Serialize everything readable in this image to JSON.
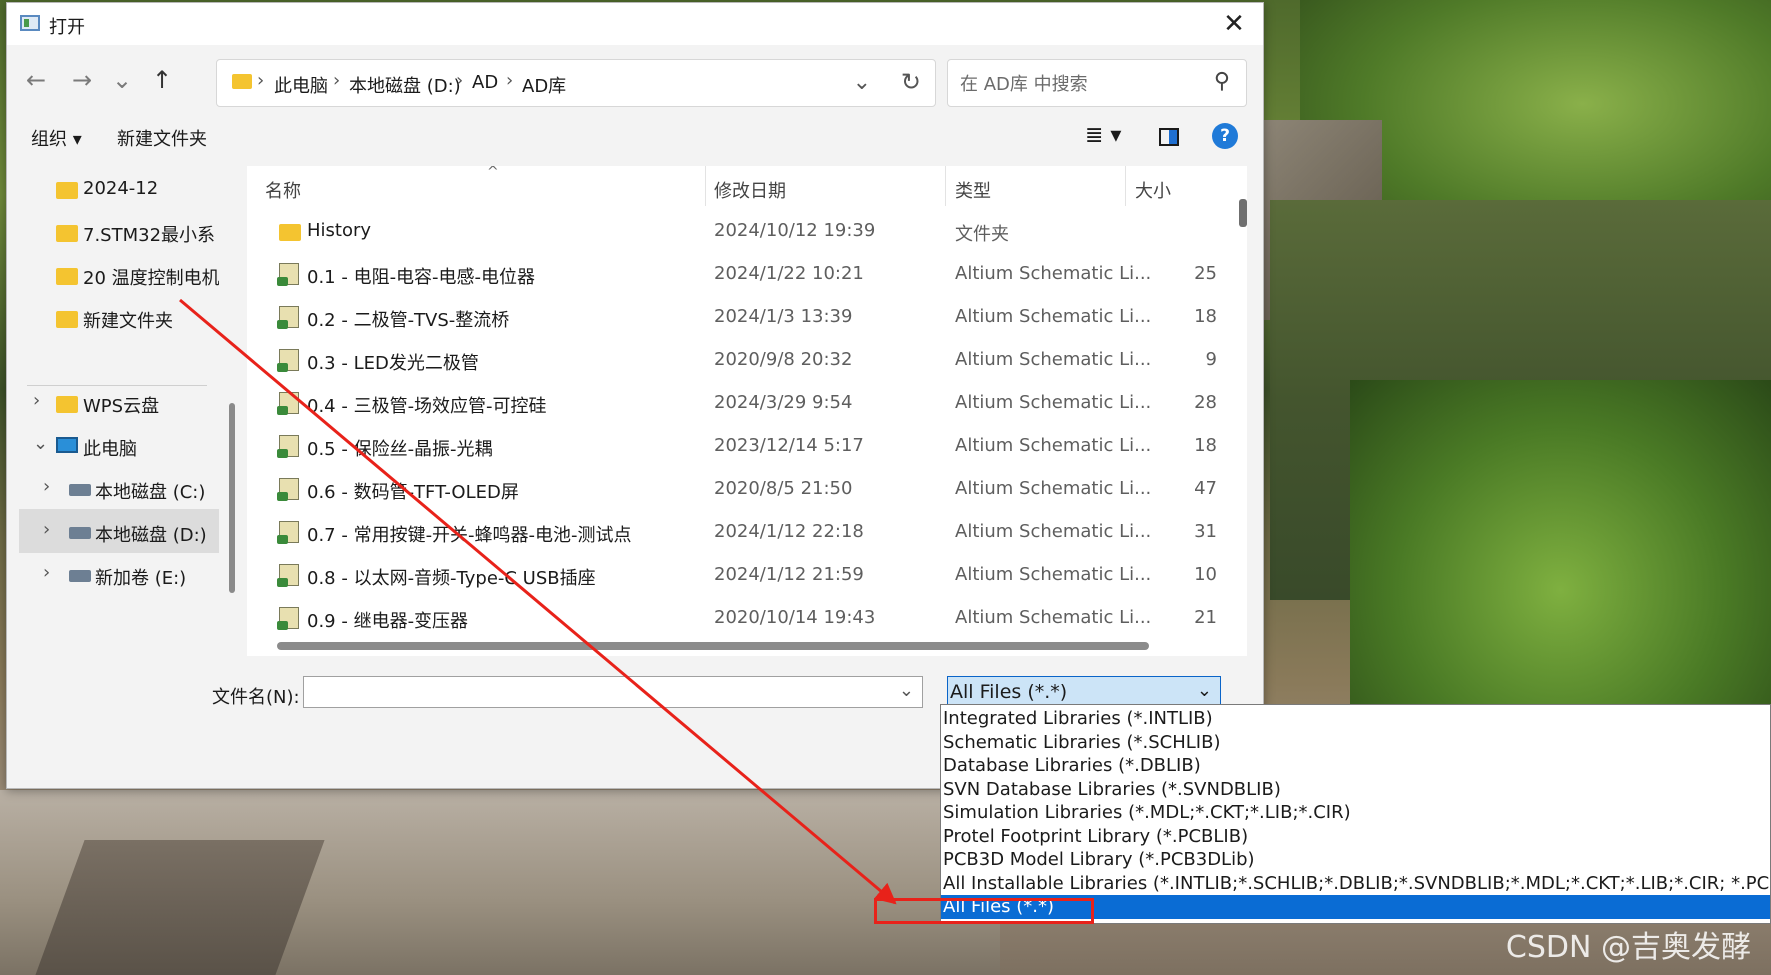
{
  "window": {
    "title": "打开",
    "close": "✕"
  },
  "nav": {
    "back": "←",
    "forward": "→",
    "recent": "⌄",
    "up": "↑"
  },
  "address": {
    "crumbs": [
      "此电脑",
      "本地磁盘 (D:)",
      "AD",
      "AD库"
    ],
    "separator": "›",
    "dropdown": "⌄",
    "refresh": "↻"
  },
  "search": {
    "placeholder": "在 AD库 中搜索",
    "icon": "search-icon"
  },
  "toolbar": {
    "organize": "组织 ▾",
    "new_folder": "新建文件夹",
    "view": "≣ ▾",
    "help": "?"
  },
  "sidebar": {
    "items": [
      {
        "label": "2024-12",
        "icon": "folder-icon"
      },
      {
        "label": "7.STM32最小系",
        "icon": "folder-icon"
      },
      {
        "label": "20 温度控制电机",
        "icon": "folder-icon"
      },
      {
        "label": "新建文件夹",
        "icon": "folder-icon"
      },
      {
        "label": "WPS云盘",
        "icon": "folder-icon",
        "chevron": "›"
      },
      {
        "label": "此电脑",
        "icon": "pc-icon",
        "chevron": "⌄"
      },
      {
        "label": "本地磁盘 (C:)",
        "icon": "drive-icon",
        "chevron": "›"
      },
      {
        "label": "本地磁盘 (D:)",
        "icon": "drive-icon",
        "chevron": "›",
        "selected": true
      },
      {
        "label": "新加卷 (E:)",
        "icon": "drive-icon",
        "chevron": "›"
      }
    ]
  },
  "columns": {
    "name": "名称",
    "date": "修改日期",
    "type": "类型",
    "size": "大小",
    "sort_indicator": "^"
  },
  "files": [
    {
      "name": "History",
      "date": "2024/10/12 19:39",
      "type": "文件夹",
      "size": "",
      "kind": "folder"
    },
    {
      "name": "0.1 - 电阻-电容-电感-电位器",
      "date": "2024/1/22 10:21",
      "type": "Altium Schematic Li...",
      "size": "25",
      "kind": "lib"
    },
    {
      "name": "0.2 - 二极管-TVS-整流桥",
      "date": "2024/1/3 13:39",
      "type": "Altium Schematic Li...",
      "size": "18",
      "kind": "lib"
    },
    {
      "name": "0.3 - LED发光二极管",
      "date": "2020/9/8 20:32",
      "type": "Altium Schematic Li...",
      "size": "9",
      "kind": "lib"
    },
    {
      "name": "0.4 - 三极管-场效应管-可控硅",
      "date": "2024/3/29 9:54",
      "type": "Altium Schematic Li...",
      "size": "28",
      "kind": "lib"
    },
    {
      "name": "0.5 - 保险丝-晶振-光耦",
      "date": "2023/12/14 5:17",
      "type": "Altium Schematic Li...",
      "size": "18",
      "kind": "lib"
    },
    {
      "name": "0.6 - 数码管-TFT-OLED屏",
      "date": "2020/8/5 21:50",
      "type": "Altium Schematic Li...",
      "size": "47",
      "kind": "lib"
    },
    {
      "name": "0.7 - 常用按键-开关-蜂鸣器-电池-测试点",
      "date": "2024/1/12 22:18",
      "type": "Altium Schematic Li...",
      "size": "31",
      "kind": "lib"
    },
    {
      "name": "0.8 - 以太网-音频-Type-C USB插座",
      "date": "2024/1/12 21:59",
      "type": "Altium Schematic Li...",
      "size": "10",
      "kind": "lib"
    },
    {
      "name": "0.9 - 继电器-变压器",
      "date": "2020/10/14 19:43",
      "type": "Altium Schematic Li...",
      "size": "21",
      "kind": "lib"
    }
  ],
  "bottom": {
    "filename_label": "文件名(N):",
    "filename_value": "",
    "filetype_value": "All Files (*.*)",
    "dropdown": "⌄"
  },
  "filetype_options": [
    "Integrated Libraries (*.INTLIB)",
    "Schematic Libraries (*.SCHLIB)",
    "Database Libraries (*.DBLIB)",
    "SVN Database Libraries (*.SVNDBLIB)",
    "Simulation Libraries (*.MDL;*.CKT;*.LIB;*.CIR)",
    "Protel Footprint Library (*.PCBLIB)",
    "PCB3D Model Library (*.PCB3DLib)",
    "All Installable Libraries (*.INTLIB;*.SCHLIB;*.DBLIB;*.SVNDBLIB;*.MDL;*.CKT;*.LIB;*.CIR; *.PCBLIB; *.I",
    "All Files (*.*)"
  ],
  "selected_option": "All Files (*.*)",
  "watermark": "CSDN @吉奥发酵",
  "colors": {
    "selection": "#0a6cd4",
    "annotation": "#e8221a",
    "folder": "#f4c430"
  }
}
